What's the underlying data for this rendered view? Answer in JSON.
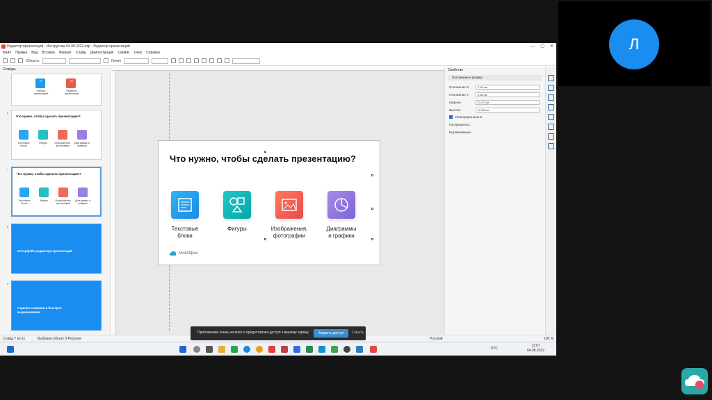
{
  "window": {
    "title": "Редактор презентаций - Инструктаж 04.08.2022.odp - Редактор презентаций",
    "controls": [
      "—",
      "▢",
      "✕"
    ]
  },
  "menu": [
    "Файл",
    "Правка",
    "Вид",
    "Вставка",
    "Формат",
    "Слайд",
    "Демонстрация",
    "Сервис",
    "Окно",
    "Справка"
  ],
  "toolbar": {
    "area_label": "Область",
    "line_label": "Линия"
  },
  "slides_panel": {
    "title": "Слайды",
    "thumb1": {
      "items": [
        {
          "num": "01",
          "label": "Наборы презентаций"
        },
        {
          "num": "02",
          "label": "Редактор презентаций"
        }
      ]
    },
    "thumb2": {
      "number": "6",
      "title": "Что нужно, чтобы сделать презентацию?"
    },
    "thumb3": {
      "number": "7",
      "title": "Что нужно, чтобы сделать презентацию?"
    },
    "mini_captions": [
      "Текстовые блоки",
      "Фигуры",
      "Изображения, фотографии",
      "Диаграммы и графики"
    ],
    "thumb4": {
      "number": "8",
      "text": "Интерфейс редактора презентаций"
    },
    "thumb5": {
      "number": "9",
      "text": "Горячие клавиши и быстрое выравнивание"
    }
  },
  "slide": {
    "title": "Что нужно, чтобы сделать презентацию?",
    "items": [
      {
        "icon": "text-blocks-icon",
        "label1": "Текстовые",
        "label2": "блоки",
        "color1": "#29b6f6",
        "color2": "#1e88e5"
      },
      {
        "icon": "shapes-icon",
        "label1": "Фигуры",
        "label2": "",
        "color1": "#26c6c6",
        "color2": "#00a8a8"
      },
      {
        "icon": "image-icon",
        "label1": "Изображения,",
        "label2": "фотографии",
        "color1": "#ff7a5c",
        "color2": "#e84a4a"
      },
      {
        "icon": "chart-icon",
        "label1": "Диаграммы",
        "label2": "и графики",
        "color1": "#a78be8",
        "color2": "#7e63d6"
      }
    ],
    "logo_text": "МойОфис"
  },
  "properties": {
    "title": "Свойства",
    "section": "Положение и размер",
    "rows": [
      {
        "label": "Положение X:",
        "value": "2,90 см"
      },
      {
        "label": "Положение Y:",
        "value": "0,88 см"
      },
      {
        "label": "Ширина:",
        "value": "24,47 см"
      },
      {
        "label": "Высота:",
        "value": "10,35 см"
      }
    ],
    "keep_ratio": "Пропорционально",
    "distribute": "Распределить:",
    "align": "Выравнивание:"
  },
  "status": {
    "slide": "Слайд 7 из 11",
    "selection": "Выбрана объект 9 Рисунок",
    "language": "Русский",
    "zoom": "100 %"
  },
  "notification": {
    "text": "Приложению очень нелегко о предоставлен доступ к вашему экрану.",
    "share_button": "Закрыть доступ",
    "hide_button": "Скрыть"
  },
  "taskbar": {
    "lang": "РУС",
    "time": "11:07",
    "date": "04.08.2022"
  },
  "participant": {
    "initial": "Л"
  }
}
